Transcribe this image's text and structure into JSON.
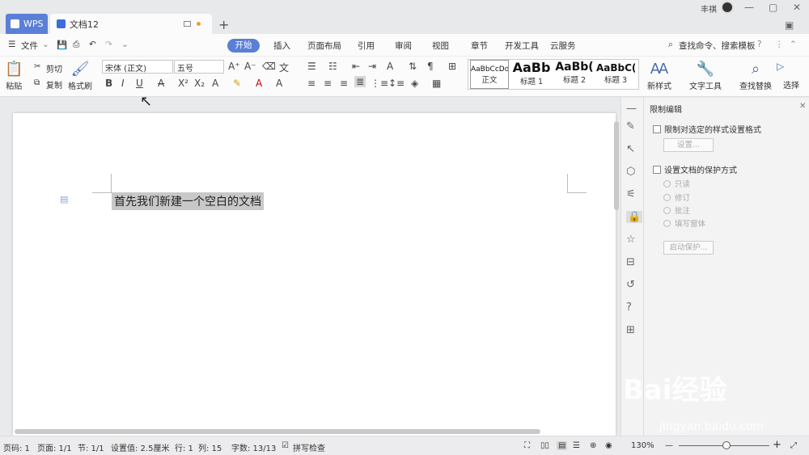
{
  "titlebar": {
    "wps_tab": "WPS",
    "doc_tab": "文档12",
    "user_name": "丰祺"
  },
  "menu": {
    "file": "文件",
    "tabs": [
      "开始",
      "插入",
      "页面布局",
      "引用",
      "审阅",
      "视图",
      "章节",
      "开发工具",
      "云服务"
    ],
    "search": "查找命令、搜索模板"
  },
  "ribbon": {
    "paste": "粘贴",
    "cut": "剪切",
    "copy": "复制",
    "format_painter": "格式刷",
    "font_name": "宋体 (正文)",
    "font_size": "五号",
    "styles": [
      {
        "preview": "AaBbCcDd",
        "label": "正文"
      },
      {
        "preview": "AaBb",
        "label": "标题 1"
      },
      {
        "preview": "AaBb(",
        "label": "标题 2"
      },
      {
        "preview": "AaBbC(",
        "label": "标题 3"
      }
    ],
    "new_style": "新样式",
    "text_tools": "文字工具",
    "find_replace": "查找替换",
    "select": "选择"
  },
  "document": {
    "text": "首先我们新建一个空白的文档"
  },
  "panel": {
    "title": "限制编辑",
    "restrict_format": "限制对选定的样式设置格式",
    "settings_button": "设置...",
    "protect_method": "设置文档的保护方式",
    "options": [
      "只读",
      "修订",
      "批注",
      "填写窗体"
    ],
    "start_button": "启动保护..."
  },
  "statusbar": {
    "page_code": "页码: 1",
    "page": "页面: 1/1",
    "section": "节: 1/1",
    "setting": "设置值: 2.5厘米",
    "row": "行: 1",
    "col": "列: 15",
    "words": "字数: 13/13",
    "spellcheck": "拼写检查",
    "zoom": "130%"
  },
  "watermark": {
    "brand": "Bai经验",
    "url": "jingyan.baidu.com"
  }
}
